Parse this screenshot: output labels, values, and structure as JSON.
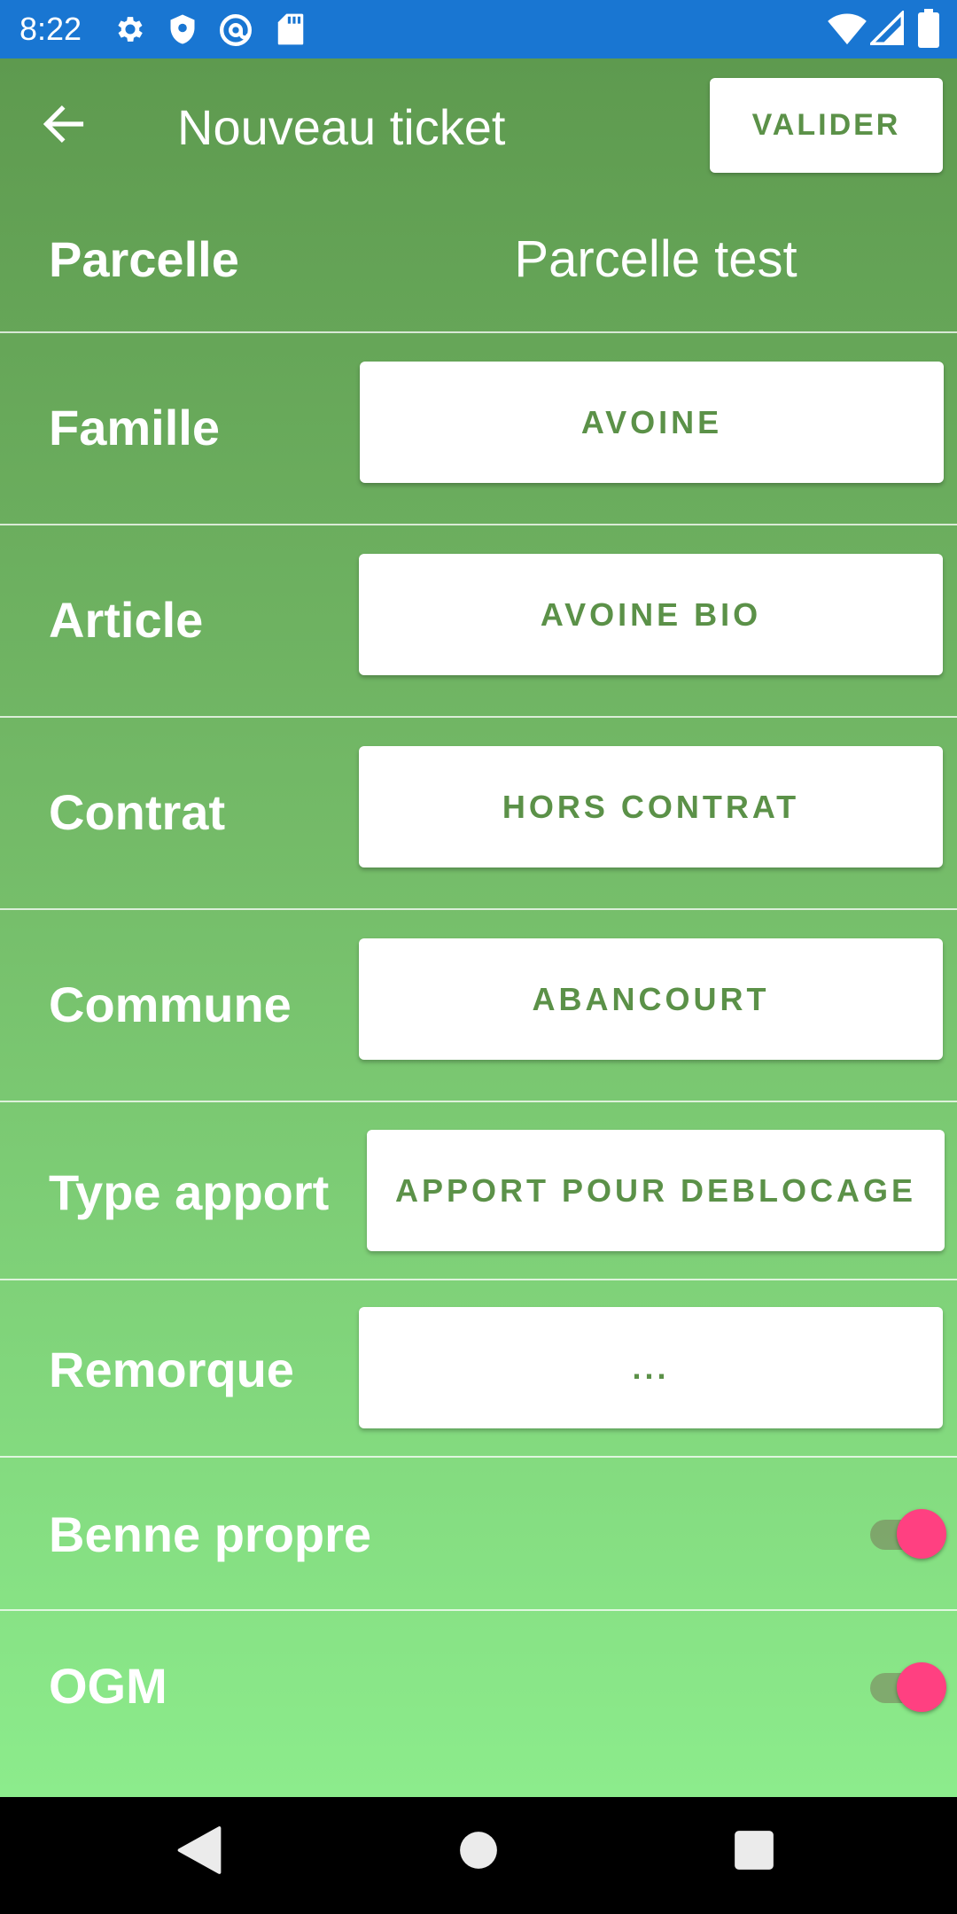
{
  "status_bar": {
    "time": "8:22",
    "left_icons": [
      "gear-icon",
      "shield-icon",
      "at-sign-icon",
      "sd-card-icon"
    ],
    "right_icons": [
      "wifi-icon",
      "cell-signal-icon",
      "battery-icon"
    ],
    "color": "#1976d2"
  },
  "app_bar": {
    "back_icon": "arrow-left-icon",
    "title": "Nouveau ticket",
    "valider_label": "VALIDER"
  },
  "form": {
    "parcelle": {
      "label": "Parcelle",
      "value": "Parcelle test"
    },
    "famille": {
      "label": "Famille",
      "value": "AVOINE"
    },
    "article": {
      "label": "Article",
      "value": "AVOINE BIO"
    },
    "contrat": {
      "label": "Contrat",
      "value": "HORS CONTRAT"
    },
    "commune": {
      "label": "Commune",
      "value": "ABANCOURT"
    },
    "type_apport": {
      "label": "Type apport",
      "value": "APPORT POUR DEBLOCAGE"
    },
    "remorque": {
      "label": "Remorque",
      "value": "..."
    },
    "benne_propre": {
      "label": "Benne propre",
      "checked": true
    },
    "ogm": {
      "label": "OGM",
      "checked": true
    }
  },
  "colors": {
    "accent_green": "#5b9148",
    "toggle_on": "#ff4081",
    "top_gradient": "#5e9a4f",
    "bottom_gradient": "#8cec8c"
  },
  "nav_bar": {
    "icons": [
      "back-triangle-icon",
      "home-circle-icon",
      "recents-square-icon"
    ]
  }
}
